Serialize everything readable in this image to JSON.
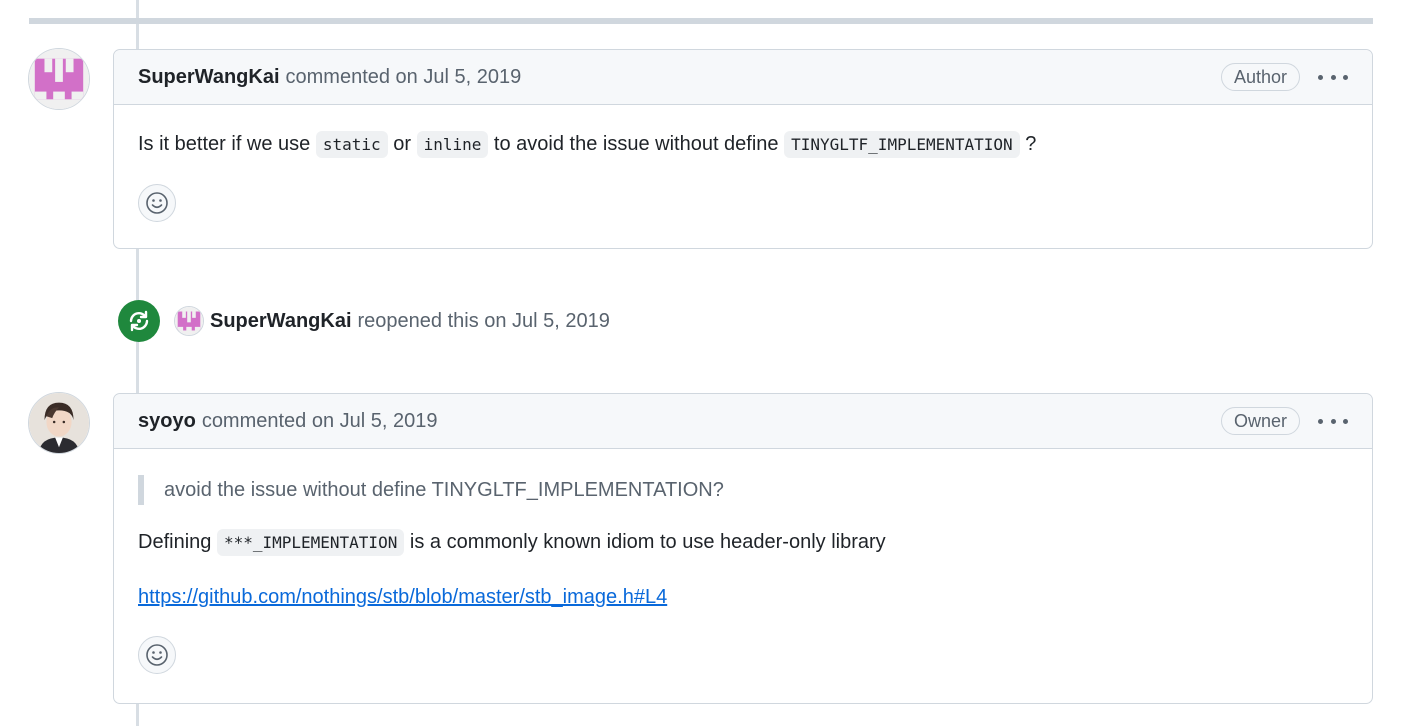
{
  "comments": [
    {
      "author": "SuperWangKai",
      "action": "commented on Jul 5, 2019",
      "badge": "Author",
      "body": {
        "p1": "Is it better if we use ",
        "code1": "static",
        "p2": " or ",
        "code2": "inline",
        "p3": " to avoid the issue without define ",
        "code3": "TINYGLTF_IMPLEMENTATION",
        "p4": " ?"
      }
    },
    {
      "author": "syoyo",
      "action": "commented on Jul 5, 2019",
      "badge": "Owner",
      "body": {
        "quote": "avoid the issue without define TINYGLTF_IMPLEMENTATION?",
        "p1": "Defining ",
        "code1": "***_IMPLEMENTATION",
        "p2": " is a commonly known idiom to use header-only library",
        "link": "https://github.com/nothings/stb/blob/master/stb_image.h#L4"
      }
    }
  ],
  "event": {
    "actor": "SuperWangKai",
    "text": "reopened this on Jul 5, 2019",
    "icon": "reopen-icon"
  },
  "icons": {
    "more": "kebab-horizontal-icon",
    "reaction": "smiley-icon"
  },
  "colors": {
    "event_green": "#1f883d",
    "link_blue": "#0969da",
    "identicon_pink": "#d270c8"
  }
}
